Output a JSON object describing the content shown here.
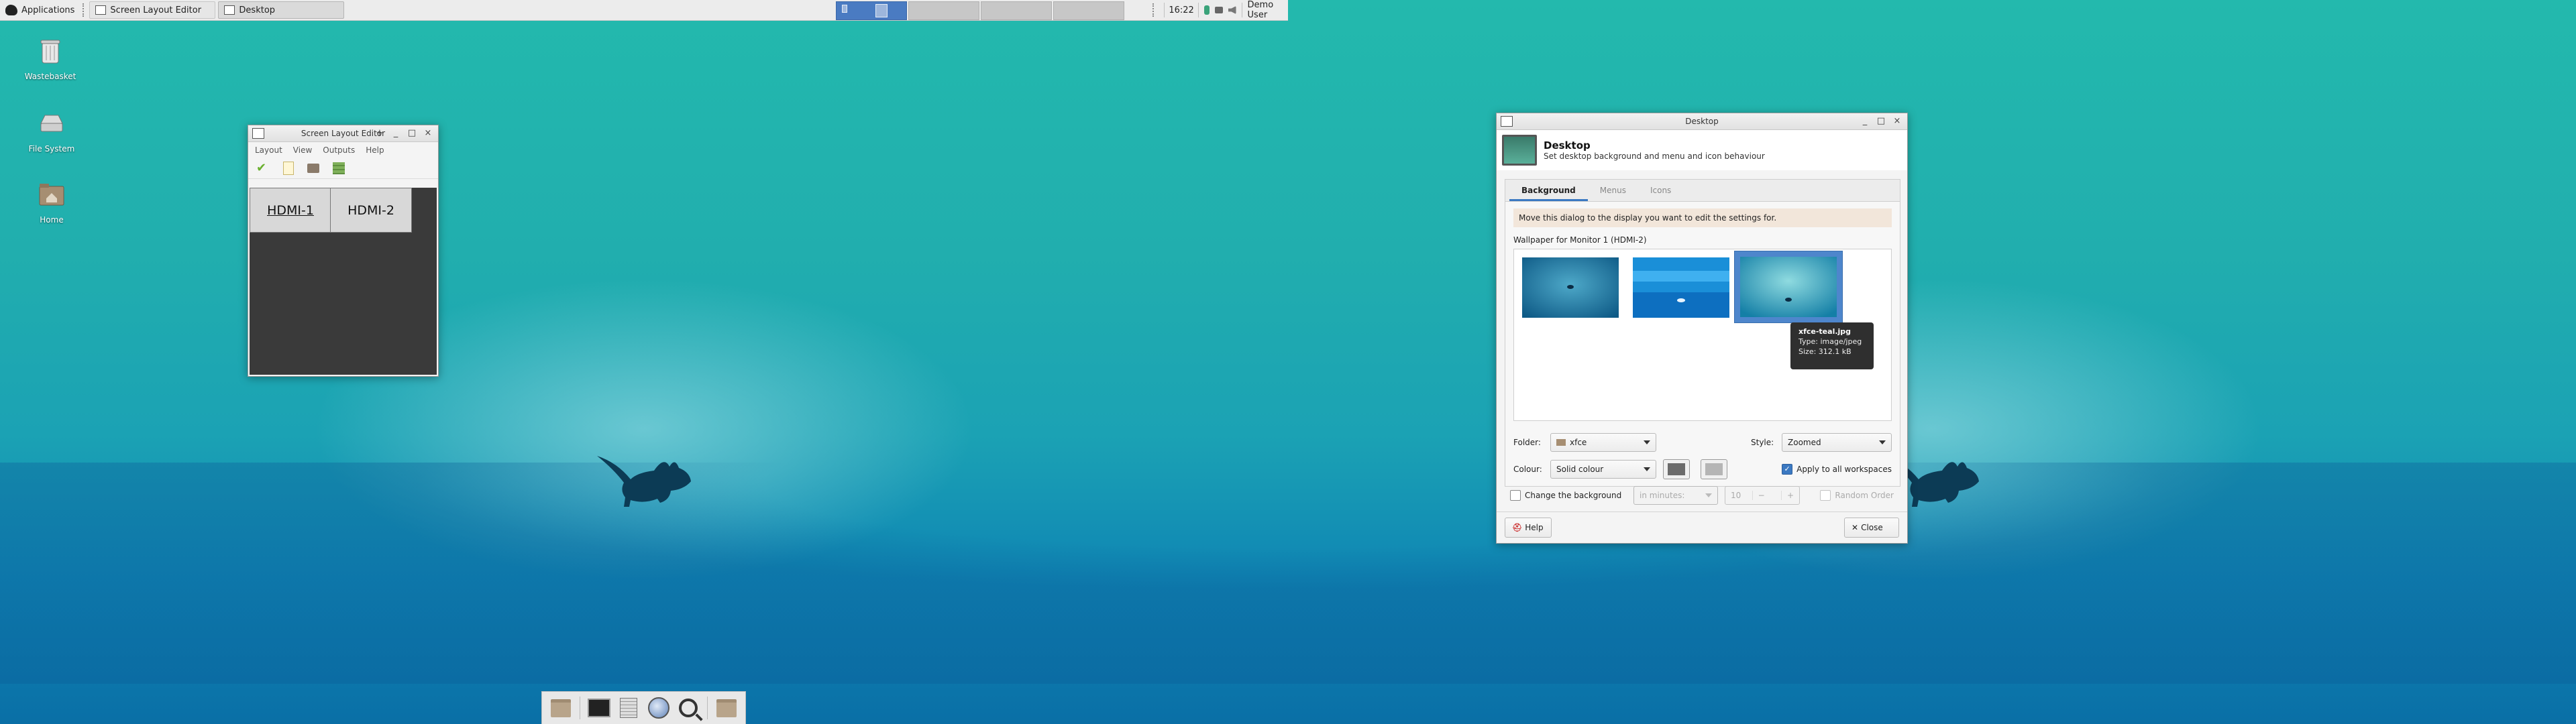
{
  "top_panel": {
    "applications_label": "Applications",
    "tasks": [
      {
        "label": "Screen Layout Editor",
        "active": false
      },
      {
        "label": "Desktop",
        "active": true
      }
    ],
    "workspace_count": 4,
    "active_workspace": 1,
    "clock": "16:22",
    "user": "Demo User"
  },
  "desktop_icons": [
    {
      "name": "wastebasket",
      "label": "Wastebasket",
      "icon": "trash-icon"
    },
    {
      "name": "file-system",
      "label": "File System",
      "icon": "drive-icon"
    },
    {
      "name": "home",
      "label": "Home",
      "icon": "home-folder-icon"
    }
  ],
  "screen_layout_editor": {
    "title": "Screen Layout Editor",
    "menu": [
      "Layout",
      "View",
      "Outputs",
      "Help"
    ],
    "toolbar": [
      "apply-icon",
      "new-layout-icon",
      "save-icon",
      "manage-icon"
    ],
    "outputs": [
      {
        "label": "HDMI-1",
        "selected": true
      },
      {
        "label": "HDMI-2",
        "selected": false
      }
    ]
  },
  "desktop_dialog": {
    "window_title": "Desktop",
    "header_title": "Desktop",
    "header_subtitle": "Set desktop background and menu and icon behaviour",
    "tabs": [
      {
        "label": "Background",
        "active": true
      },
      {
        "label": "Menus",
        "active": false
      },
      {
        "label": "Icons",
        "active": false
      }
    ],
    "info_message": "Move this dialog to the display you want to edit the settings for.",
    "wallpaper_label": "Wallpaper for Monitor 1 (HDMI-2)",
    "tooltip": {
      "filename": "xfce-teal.jpg",
      "type": "Type: image/jpeg",
      "size": "Size: 312.1 kB"
    },
    "folder_label": "Folder:",
    "folder_value": "xfce",
    "style_label": "Style:",
    "style_value": "Zoomed",
    "colour_label": "Colour:",
    "colour_value": "Solid colour",
    "colour1": "#6b6b6b",
    "colour2": "#b5b5b5",
    "apply_all_label": "Apply to all workspaces",
    "apply_all_checked": true,
    "change_bg_label": "Change the background",
    "change_bg_checked": false,
    "interval_unit": "in minutes:",
    "interval_value": "10",
    "random_order_label": "Random Order",
    "help_label": "Help",
    "close_label": "Close"
  },
  "colors": {
    "accent": "#3b79c2",
    "desktop_teal": "#1fa6a4"
  }
}
